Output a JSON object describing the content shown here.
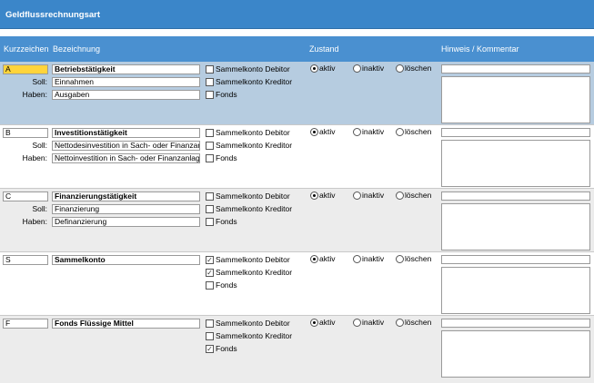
{
  "window": {
    "title": "Geldflussrechnungsart"
  },
  "columns": {
    "kurzzeichen": "Kurzzeichen",
    "bezeichnung": "Bezeichnung",
    "zustand": "Zustand",
    "hinweis": "Hinweis / Kommentar"
  },
  "labels": {
    "soll": "Soll:",
    "haben": "Haben:"
  },
  "options": {
    "debitor": "Sammelkonto Debitor",
    "kreditor": "Sammelkonto Kreditor",
    "fonds": "Fonds",
    "aktiv": "aktiv",
    "inaktiv": "inaktiv",
    "loeschen": "löschen"
  },
  "rows": [
    {
      "code": "A",
      "name": "Betriebstätigkeit",
      "soll": "Einnahmen",
      "haben": "Ausgaben",
      "debitor": false,
      "kreditor": false,
      "fonds": false,
      "state": "aktiv"
    },
    {
      "code": "B",
      "name": "Investitionstätigkeit",
      "soll": "Nettodesinvestition in Sach- oder Finanzanlagen",
      "haben": "Nettoinvestition in Sach- oder Finanzanlagen",
      "debitor": false,
      "kreditor": false,
      "fonds": false,
      "state": "aktiv"
    },
    {
      "code": "C",
      "name": "Finanzierungstätigkeit",
      "soll": "Finanzierung",
      "haben": "Definanzierung",
      "debitor": false,
      "kreditor": false,
      "fonds": false,
      "state": "aktiv"
    },
    {
      "code": "S",
      "name": "Sammelkonto",
      "soll": "",
      "haben": "",
      "debitor": true,
      "kreditor": true,
      "fonds": false,
      "state": "aktiv"
    },
    {
      "code": "F",
      "name": "Fonds Flüssige Mittel",
      "soll": "",
      "haben": "",
      "debitor": false,
      "kreditor": false,
      "fonds": true,
      "state": "aktiv"
    }
  ]
}
